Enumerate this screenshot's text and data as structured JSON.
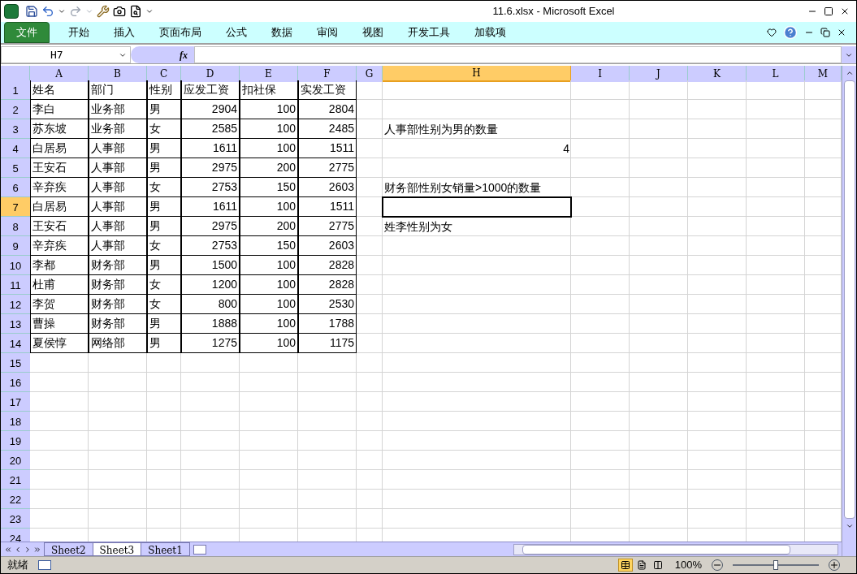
{
  "window": {
    "title": "11.6.xlsx  -  Microsoft Excel"
  },
  "ribbon_tabs": [
    {
      "label": "文件",
      "kind": "file"
    },
    {
      "label": "开始",
      "kind": "tab",
      "selected": false
    },
    {
      "label": "插入",
      "kind": "tab",
      "selected": false
    },
    {
      "label": "页面布局",
      "kind": "tab",
      "selected": false
    },
    {
      "label": "公式",
      "kind": "tab",
      "selected": false
    },
    {
      "label": "数据",
      "kind": "tab",
      "selected": false
    },
    {
      "label": "审阅",
      "kind": "tab",
      "selected": false
    },
    {
      "label": "视图",
      "kind": "tab",
      "selected": false
    },
    {
      "label": "开发工具",
      "kind": "tab",
      "selected": false
    },
    {
      "label": "加载项",
      "kind": "tab",
      "selected": false
    }
  ],
  "formula_bar": {
    "name_box": "H7",
    "fx": "fx"
  },
  "columns": [
    {
      "header": "A",
      "selected": false
    },
    {
      "header": "B",
      "selected": false
    },
    {
      "header": "C",
      "selected": false
    },
    {
      "header": "D",
      "selected": false
    },
    {
      "header": "E",
      "selected": false
    },
    {
      "header": "F",
      "selected": false
    },
    {
      "header": "G",
      "selected": false
    },
    {
      "header": "H",
      "selected": true
    },
    {
      "header": "I",
      "selected": false
    },
    {
      "header": "J",
      "selected": false
    },
    {
      "header": "K",
      "selected": false
    },
    {
      "header": "L",
      "selected": false
    },
    {
      "header": "M",
      "selected": false
    }
  ],
  "rows": [
    {
      "header": "1",
      "selected": false,
      "cells": [
        {
          "value": "姓名",
          "kind": "text",
          "bordered": true
        },
        {
          "value": "部门",
          "kind": "text",
          "bordered": true
        },
        {
          "value": "性别",
          "kind": "text",
          "bordered": true
        },
        {
          "value": "应发工资",
          "kind": "text",
          "bordered": true
        },
        {
          "value": "扣社保",
          "kind": "text",
          "bordered": true
        },
        {
          "value": "实发工资",
          "kind": "text",
          "bordered": true
        }
      ]
    },
    {
      "header": "2",
      "selected": false,
      "cells": [
        {
          "value": "李白",
          "kind": "text",
          "bordered": true
        },
        {
          "value": "业务部",
          "kind": "text",
          "bordered": true
        },
        {
          "value": "男",
          "kind": "text",
          "bordered": true
        },
        {
          "value": "2904",
          "kind": "number",
          "bordered": true
        },
        {
          "value": "100",
          "kind": "number",
          "bordered": true
        },
        {
          "value": "2804",
          "kind": "number",
          "bordered": true
        }
      ]
    },
    {
      "header": "3",
      "selected": false,
      "cells": [
        {
          "value": "苏东坡",
          "kind": "text",
          "bordered": true
        },
        {
          "value": "业务部",
          "kind": "text",
          "bordered": true
        },
        {
          "value": "女",
          "kind": "text",
          "bordered": true
        },
        {
          "value": "2585",
          "kind": "number",
          "bordered": true
        },
        {
          "value": "100",
          "kind": "number",
          "bordered": true
        },
        {
          "value": "2485",
          "kind": "number",
          "bordered": true
        },
        null,
        {
          "value": "人事部性别为男的数量",
          "kind": "text",
          "bordered": false
        }
      ]
    },
    {
      "header": "4",
      "selected": false,
      "cells": [
        {
          "value": "白居易",
          "kind": "text",
          "bordered": true
        },
        {
          "value": "人事部",
          "kind": "text",
          "bordered": true
        },
        {
          "value": "男",
          "kind": "text",
          "bordered": true
        },
        {
          "value": "1611",
          "kind": "number",
          "bordered": true
        },
        {
          "value": "100",
          "kind": "number",
          "bordered": true
        },
        {
          "value": "1511",
          "kind": "number",
          "bordered": true
        },
        null,
        {
          "value": "4",
          "kind": "number",
          "bordered": false
        }
      ]
    },
    {
      "header": "5",
      "selected": false,
      "cells": [
        {
          "value": "王安石",
          "kind": "text",
          "bordered": true
        },
        {
          "value": "人事部",
          "kind": "text",
          "bordered": true
        },
        {
          "value": "男",
          "kind": "text",
          "bordered": true
        },
        {
          "value": "2975",
          "kind": "number",
          "bordered": true
        },
        {
          "value": "200",
          "kind": "number",
          "bordered": true
        },
        {
          "value": "2775",
          "kind": "number",
          "bordered": true
        }
      ]
    },
    {
      "header": "6",
      "selected": false,
      "cells": [
        {
          "value": "辛弃疾",
          "kind": "text",
          "bordered": true
        },
        {
          "value": "人事部",
          "kind": "text",
          "bordered": true
        },
        {
          "value": "女",
          "kind": "text",
          "bordered": true
        },
        {
          "value": "2753",
          "kind": "number",
          "bordered": true
        },
        {
          "value": "150",
          "kind": "number",
          "bordered": true
        },
        {
          "value": "2603",
          "kind": "number",
          "bordered": true
        },
        null,
        {
          "value": "财务部性别女销量>1000的数量",
          "kind": "text",
          "bordered": false
        }
      ]
    },
    {
      "header": "7",
      "selected": true,
      "cells": [
        {
          "value": "白居易",
          "kind": "text",
          "bordered": true
        },
        {
          "value": "人事部",
          "kind": "text",
          "bordered": true
        },
        {
          "value": "男",
          "kind": "text",
          "bordered": true
        },
        {
          "value": "1611",
          "kind": "number",
          "bordered": true
        },
        {
          "value": "100",
          "kind": "number",
          "bordered": true
        },
        {
          "value": "1511",
          "kind": "number",
          "bordered": true
        }
      ]
    },
    {
      "header": "8",
      "selected": false,
      "cells": [
        {
          "value": "王安石",
          "kind": "text",
          "bordered": true
        },
        {
          "value": "人事部",
          "kind": "text",
          "bordered": true
        },
        {
          "value": "男",
          "kind": "text",
          "bordered": true
        },
        {
          "value": "2975",
          "kind": "number",
          "bordered": true
        },
        {
          "value": "200",
          "kind": "number",
          "bordered": true
        },
        {
          "value": "2775",
          "kind": "number",
          "bordered": true
        },
        null,
        {
          "value": "姓李性别为女",
          "kind": "text",
          "bordered": false
        }
      ]
    },
    {
      "header": "9",
      "selected": false,
      "cells": [
        {
          "value": "辛弃疾",
          "kind": "text",
          "bordered": true
        },
        {
          "value": "人事部",
          "kind": "text",
          "bordered": true
        },
        {
          "value": "女",
          "kind": "text",
          "bordered": true
        },
        {
          "value": "2753",
          "kind": "number",
          "bordered": true
        },
        {
          "value": "150",
          "kind": "number",
          "bordered": true
        },
        {
          "value": "2603",
          "kind": "number",
          "bordered": true
        }
      ]
    },
    {
      "header": "10",
      "selected": false,
      "cells": [
        {
          "value": "李都",
          "kind": "text",
          "bordered": true
        },
        {
          "value": "财务部",
          "kind": "text",
          "bordered": true
        },
        {
          "value": "男",
          "kind": "text",
          "bordered": true
        },
        {
          "value": "1500",
          "kind": "number",
          "bordered": true
        },
        {
          "value": "100",
          "kind": "number",
          "bordered": true
        },
        {
          "value": "2828",
          "kind": "number",
          "bordered": true
        }
      ]
    },
    {
      "header": "11",
      "selected": false,
      "cells": [
        {
          "value": "杜甫",
          "kind": "text",
          "bordered": true
        },
        {
          "value": "财务部",
          "kind": "text",
          "bordered": true
        },
        {
          "value": "女",
          "kind": "text",
          "bordered": true
        },
        {
          "value": "1200",
          "kind": "number",
          "bordered": true
        },
        {
          "value": "100",
          "kind": "number",
          "bordered": true
        },
        {
          "value": "2828",
          "kind": "number",
          "bordered": true
        }
      ]
    },
    {
      "header": "12",
      "selected": false,
      "cells": [
        {
          "value": "李贺",
          "kind": "text",
          "bordered": true
        },
        {
          "value": "财务部",
          "kind": "text",
          "bordered": true
        },
        {
          "value": "女",
          "kind": "text",
          "bordered": true
        },
        {
          "value": "800",
          "kind": "number",
          "bordered": true
        },
        {
          "value": "100",
          "kind": "number",
          "bordered": true
        },
        {
          "value": "2530",
          "kind": "number",
          "bordered": true
        }
      ]
    },
    {
      "header": "13",
      "selected": false,
      "cells": [
        {
          "value": "曹操",
          "kind": "text",
          "bordered": true
        },
        {
          "value": "财务部",
          "kind": "text",
          "bordered": true
        },
        {
          "value": "男",
          "kind": "text",
          "bordered": true
        },
        {
          "value": "1888",
          "kind": "number",
          "bordered": true
        },
        {
          "value": "100",
          "kind": "number",
          "bordered": true
        },
        {
          "value": "1788",
          "kind": "number",
          "bordered": true
        }
      ]
    },
    {
      "header": "14",
      "selected": false,
      "cells": [
        {
          "value": "夏侯惇",
          "kind": "text",
          "bordered": true
        },
        {
          "value": "网络部",
          "kind": "text",
          "bordered": true
        },
        {
          "value": "男",
          "kind": "text",
          "bordered": true
        },
        {
          "value": "1275",
          "kind": "number",
          "bordered": true
        },
        {
          "value": "100",
          "kind": "number",
          "bordered": true
        },
        {
          "value": "1175",
          "kind": "number",
          "bordered": true
        }
      ]
    },
    {
      "header": "15",
      "selected": false
    },
    {
      "header": "16",
      "selected": false
    },
    {
      "header": "17",
      "selected": false
    },
    {
      "header": "18",
      "selected": false
    },
    {
      "header": "19",
      "selected": false
    },
    {
      "header": "20",
      "selected": false
    },
    {
      "header": "21",
      "selected": false
    },
    {
      "header": "22",
      "selected": false
    },
    {
      "header": "23",
      "selected": false
    },
    {
      "header": "24",
      "selected": false
    }
  ],
  "sheet_tabs": [
    {
      "label": "Sheet2",
      "selected": false
    },
    {
      "label": "Sheet3",
      "selected": true
    },
    {
      "label": "Sheet1",
      "selected": false
    }
  ],
  "status_bar": {
    "status": "就绪",
    "views": [
      {
        "kind": "normal",
        "selected": true
      },
      {
        "kind": "layout",
        "selected": false
      },
      {
        "kind": "break",
        "selected": false
      }
    ],
    "zoom": "100%",
    "zoom_slider": {
      "level": 0.5
    }
  }
}
